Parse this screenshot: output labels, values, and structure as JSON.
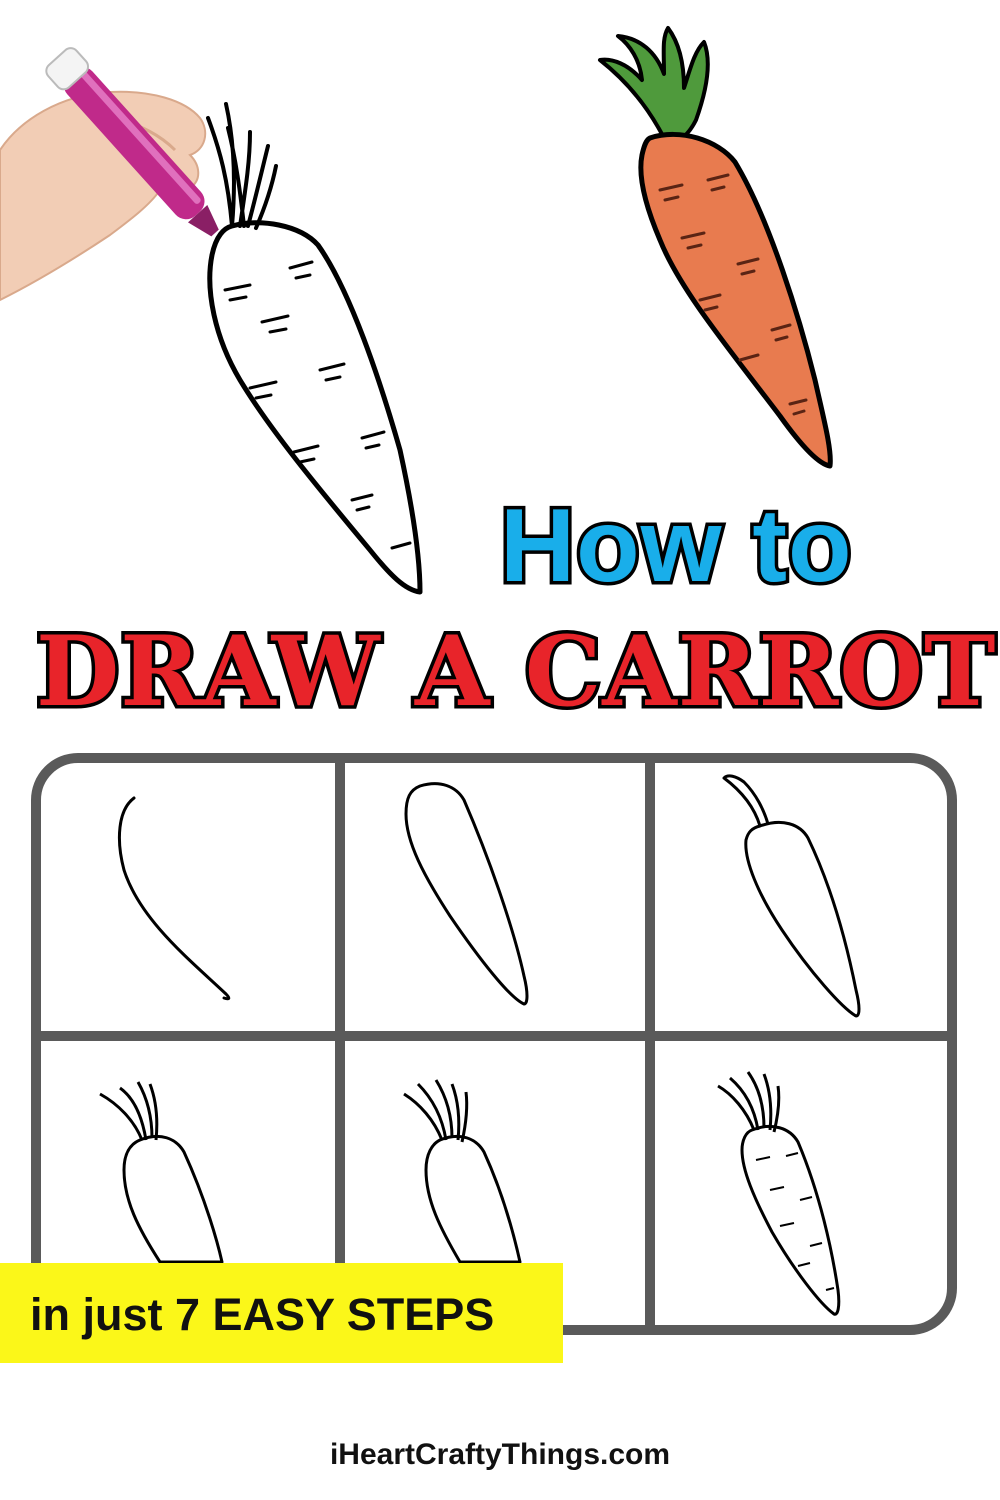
{
  "title": {
    "line1": "How to",
    "line2": "DRAW A CARROT"
  },
  "steps_banner": "in just 7 EASY STEPS",
  "website": "iHeartCraftyThings.com",
  "grid": {
    "panels": 6,
    "steps": [
      "step-1",
      "step-2",
      "step-3",
      "step-4",
      "step-5",
      "step-6"
    ]
  },
  "colors": {
    "how_to_blue": "#19aeea",
    "title_red": "#e8242a",
    "banner_yellow": "#fbf719",
    "carrot_orange": "#e87b4f",
    "leaf_green": "#4f9a3c",
    "marker_magenta": "#c02a8a",
    "grid_gray": "#5a5a5a"
  }
}
